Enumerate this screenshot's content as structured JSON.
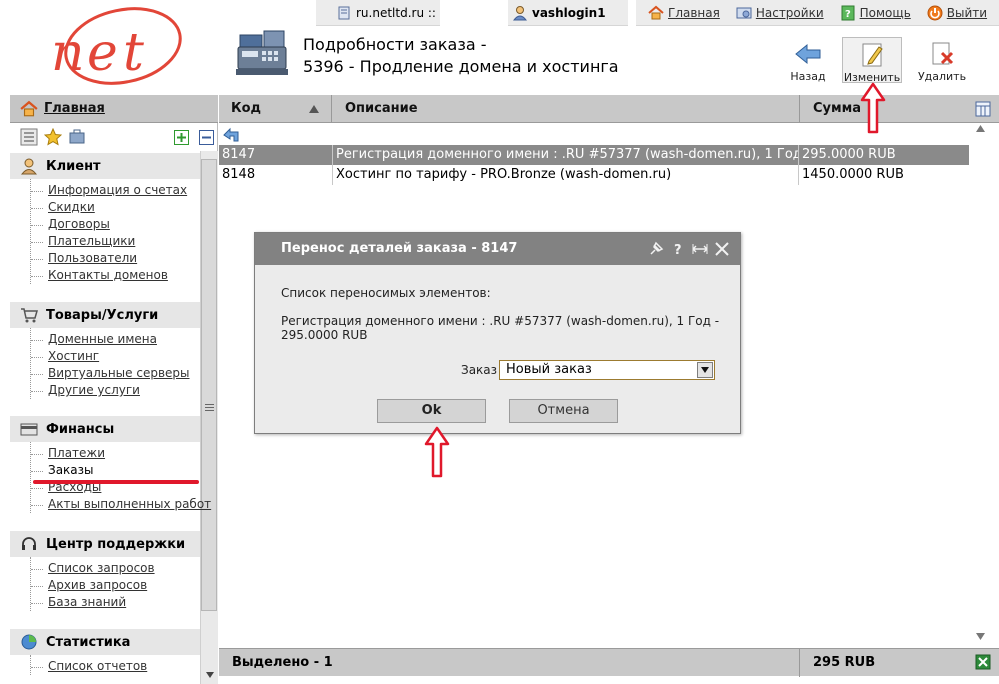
{
  "topbar": {
    "domain": "ru.netltd.ru ::",
    "user": "vashlogin1",
    "home_label": "Главная",
    "settings_label": "Настройки",
    "help_label": "Помощь",
    "logout_label": "Выйти"
  },
  "header": {
    "title_line1": "Подробности заказа -",
    "title_line2": "5396 - Продление домена и хостинга",
    "buttons": {
      "back": "Назад",
      "edit": "Изменить",
      "delete": "Удалить"
    }
  },
  "nav": {
    "home_label": "Главная",
    "sections": [
      {
        "title": "Клиент",
        "icon": "client-icon",
        "items": [
          "Информация о счетах",
          "Скидки",
          "Договоры",
          "Плательщики",
          "Пользователи",
          "Контакты доменов"
        ]
      },
      {
        "title": "Товары/Услуги",
        "icon": "cart-icon",
        "items": [
          "Доменные имена",
          "Хостинг",
          "Виртуальные серверы",
          "Другие услуги"
        ]
      },
      {
        "title": "Финансы",
        "icon": "finance-icon",
        "items": [
          "Платежи",
          "Заказы",
          "Расходы",
          "Акты выполненных работ"
        ]
      },
      {
        "title": "Центр поддержки",
        "icon": "headset-icon",
        "items": [
          "Список запросов",
          "Архив запросов",
          "База знаний"
        ]
      },
      {
        "title": "Статистика",
        "icon": "pie-chart-icon",
        "items": [
          "Список отчетов"
        ]
      }
    ]
  },
  "grid": {
    "columns": [
      "Код",
      "Описание",
      "Сумма"
    ],
    "rows": [
      {
        "code": "8147",
        "description": "Регистрация доменного имени : .RU #57377 (wash-domen.ru), 1 Год",
        "amount": "295.0000 RUB"
      },
      {
        "code": "8148",
        "description": "Хостинг по тарифу - PRO.Bronze (wash-domen.ru)",
        "amount": "1450.0000 RUB"
      }
    ],
    "footer": {
      "selected": "Выделено - 1",
      "total": "295 RUB"
    }
  },
  "dialog": {
    "title": "Перенос деталей заказа - 8147",
    "list_label": "Список переносимых элементов:",
    "item_line1": "Регистрация доменного имени : .RU #57377 (wash-domen.ru), 1 Год -",
    "item_line2": "295.0000 RUB",
    "order_label": "Заказ",
    "order_value": "Новый заказ",
    "ok_label": "Ok",
    "cancel_label": "Отмена"
  },
  "colors": {
    "accent_red": "#e0182b",
    "header_gray": "#c8c8c8",
    "selected_row": "#8a8a8a",
    "dialog_title": "#828282"
  }
}
